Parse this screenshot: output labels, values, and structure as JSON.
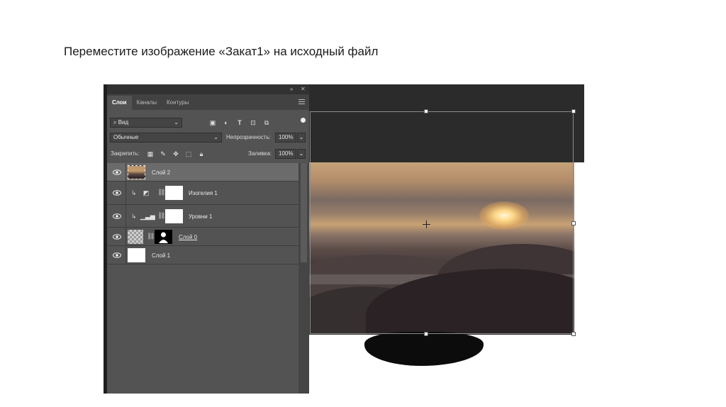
{
  "slide": {
    "title": "Переместите изображение «Закат1» на исходный файл"
  },
  "panel": {
    "tabs": [
      {
        "label": "Слои",
        "active": true
      },
      {
        "label": "Каналы",
        "active": false
      },
      {
        "label": "Контуры",
        "active": false
      }
    ],
    "filter": {
      "label": "Вид"
    },
    "blend_mode": "Обычные",
    "opacity": {
      "label": "Непрозрачность:",
      "value": "100%"
    },
    "lock": {
      "label": "Закрепить:"
    },
    "fill": {
      "label": "Заливка:",
      "value": "100%"
    },
    "layers": [
      {
        "name": "Слой 2",
        "selected": true,
        "type": "image"
      },
      {
        "name": "Изогелия 1",
        "selected": false,
        "type": "adjustment-posterize",
        "clipped": true,
        "mask": true
      },
      {
        "name": "Уровни 1",
        "selected": false,
        "type": "adjustment-levels",
        "clipped": true,
        "mask": true
      },
      {
        "name": "Слой 0",
        "selected": false,
        "type": "masked-image",
        "mask": true
      },
      {
        "name": "Слой 1",
        "selected": false,
        "type": "fill-white"
      }
    ]
  },
  "icons": {
    "collapse": "double-chevron-left-icon",
    "close": "close-icon",
    "menu": "panel-menu-icon"
  },
  "colors": {
    "panel_bg": "#535353",
    "panel_dark": "#424242",
    "canvas_bg": "#2b2b2b",
    "selected_row": "#6b6b6b"
  }
}
